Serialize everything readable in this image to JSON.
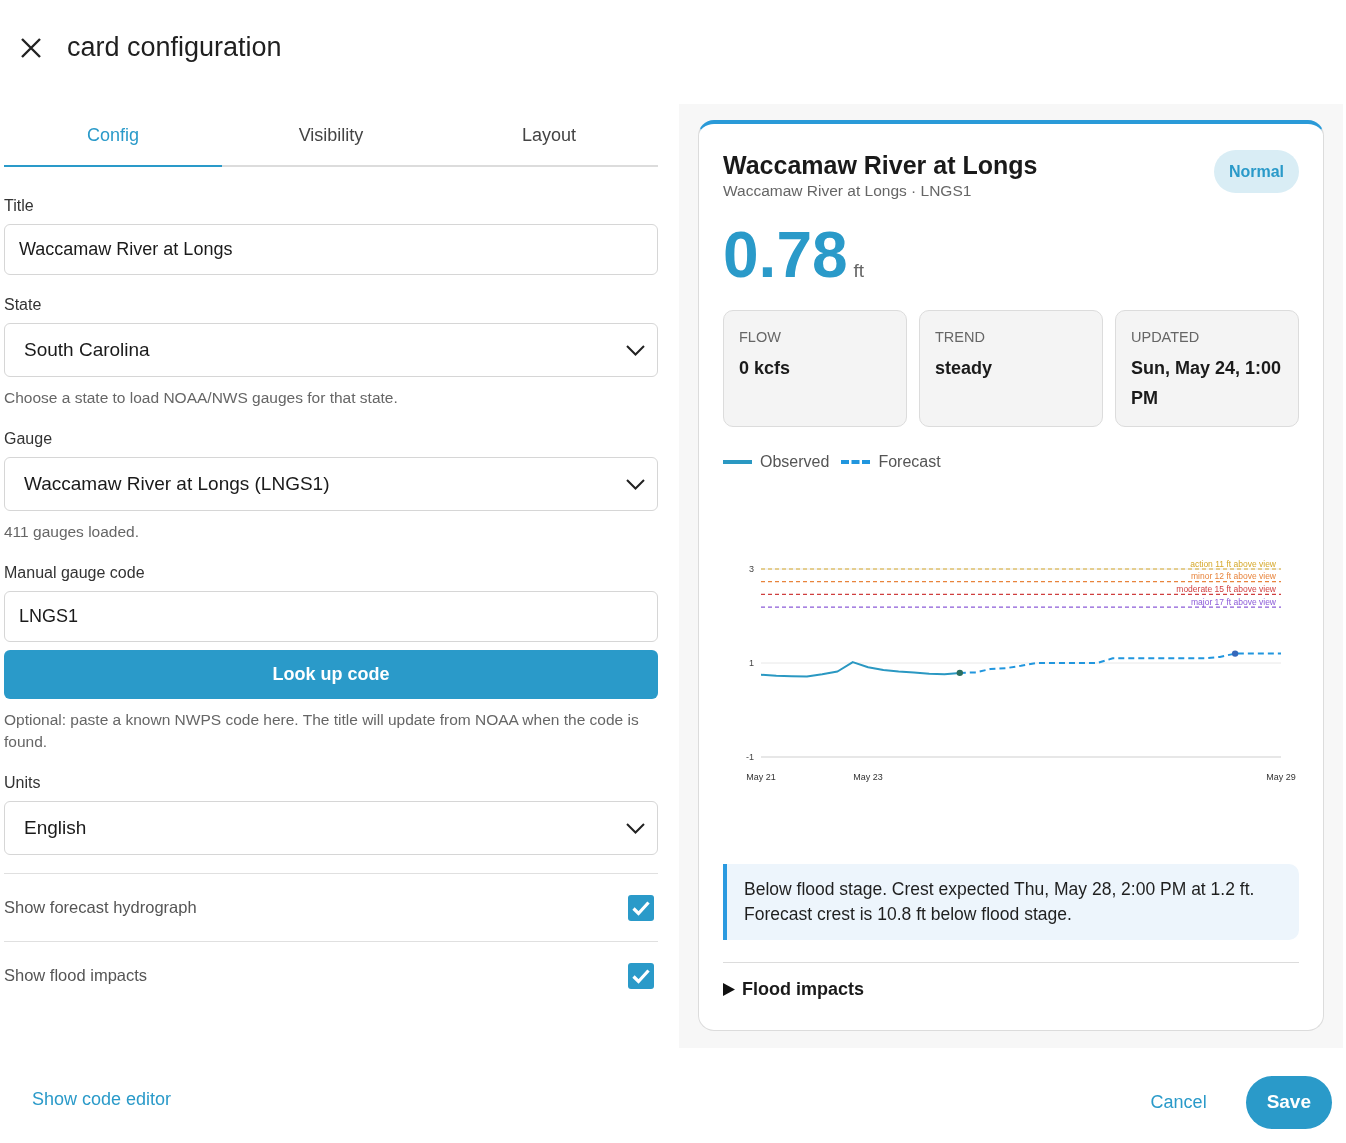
{
  "dialog": {
    "title": "card configuration"
  },
  "tabs": [
    {
      "label": "Config",
      "selected": true
    },
    {
      "label": "Visibility",
      "selected": false
    },
    {
      "label": "Layout",
      "selected": false
    }
  ],
  "form": {
    "fields": [
      {
        "kind": "text",
        "label": "Title",
        "value": "Waccamaw River at Longs"
      },
      {
        "kind": "select",
        "label": "State",
        "value": "South Carolina",
        "helper": "Choose a state to load NOAA/NWS gauges for that state."
      },
      {
        "kind": "select",
        "label": "Gauge",
        "value": "Waccamaw River at Longs (LNGS1)",
        "helper": "411 gauges loaded."
      },
      {
        "kind": "text",
        "label": "Manual gauge code",
        "value": "LNGS1",
        "action": "Look up code",
        "helper": "Optional: paste a known NWPS code here. The title will update from NOAA when the code is found."
      },
      {
        "kind": "select",
        "label": "Units",
        "value": "English"
      }
    ],
    "toggles": [
      {
        "label": "Show forecast hydrograph",
        "checked": true
      },
      {
        "label": "Show flood impacts",
        "checked": true
      }
    ]
  },
  "preview": {
    "title": "Waccamaw River at Longs",
    "subtitle": "Waccamaw River at Longs · LNGS1",
    "badge": "Normal",
    "stage": "0.78",
    "unit": "ft",
    "stats": [
      {
        "label": "FLOW",
        "value": "0 kcfs"
      },
      {
        "label": "TREND",
        "value": "steady"
      },
      {
        "label": "UPDATED",
        "value": "Sun, May 24, 1:00 PM"
      }
    ],
    "chart_data": {
      "type": "line",
      "categories": [
        "May 21",
        null,
        null,
        null,
        null,
        null,
        null,
        "May 23",
        null,
        null,
        null,
        null,
        null,
        null,
        null,
        null,
        null,
        null,
        null,
        null,
        null,
        null,
        null,
        null,
        null,
        null,
        null,
        null,
        null,
        null,
        null,
        null,
        null,
        null,
        "May 29"
      ],
      "series": [
        {
          "name": "Observed",
          "color": "#2a98c2",
          "line_style": "solid",
          "values": [
            0.75,
            0.73,
            0.72,
            0.71,
            0.76,
            0.82,
            1.02,
            0.91,
            0.85,
            0.82,
            0.8,
            0.77,
            0.76,
            0.79,
            null,
            null,
            null,
            null,
            null,
            null,
            null,
            null,
            null,
            null,
            null,
            null,
            null,
            null,
            null,
            null,
            null,
            null,
            null,
            null,
            null
          ]
        },
        {
          "name": "Forecast",
          "color": "#2196de",
          "line_style": "dashed",
          "values": [
            null,
            null,
            null,
            null,
            null,
            null,
            null,
            null,
            null,
            null,
            null,
            null,
            null,
            0.79,
            0.8,
            0.87,
            0.89,
            0.94,
            1.0,
            1.0,
            1.0,
            1.0,
            1.0,
            1.1,
            1.1,
            1.1,
            1.1,
            1.1,
            1.1,
            1.1,
            1.13,
            1.2,
            1.2,
            1.2,
            1.2
          ]
        }
      ],
      "ylim": [
        -1,
        3
      ],
      "yticks": [
        -1,
        1,
        3
      ],
      "ref_lines": [
        {
          "axis": "y",
          "value": 3,
          "label": "action 11 ft above view",
          "color": "#d6a82a"
        },
        {
          "axis": "y",
          "value": 2.73,
          "label": "minor 12 ft above view",
          "color": "#e8843c"
        },
        {
          "axis": "y",
          "value": 2.46,
          "label": "moderate 15 ft above view",
          "color": "#cf3f3f"
        },
        {
          "axis": "y",
          "value": 2.19,
          "label": "major 17 ft above view",
          "color": "#8c5bd8"
        }
      ]
    },
    "alert": "Below flood stage. Crest expected Thu, May 28, 2:00 PM at 1.2 ft. Forecast crest is 10.8 ft below flood stage.",
    "impacts": {
      "label": "Flood impacts",
      "expanded": false
    }
  },
  "footer": {
    "link": "Show code editor",
    "buttons": [
      {
        "label": "Cancel",
        "kind": "text"
      },
      {
        "label": "Save",
        "kind": "primary"
      }
    ]
  }
}
